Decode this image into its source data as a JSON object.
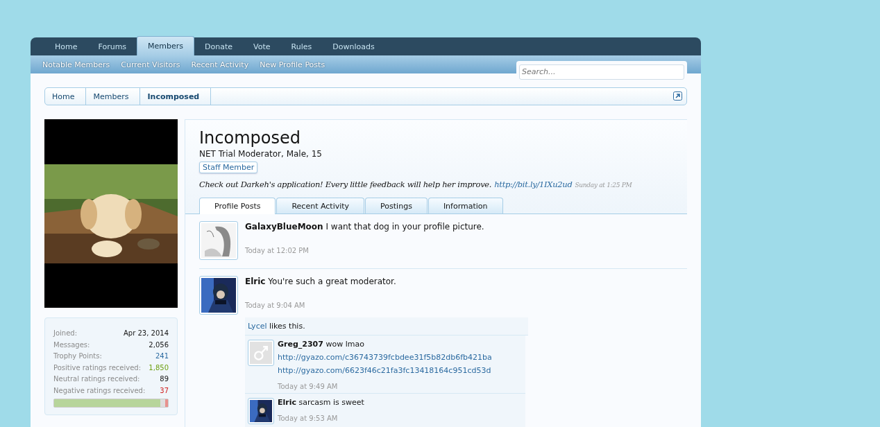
{
  "nav": {
    "tabs": [
      {
        "label": "Home",
        "selected": false
      },
      {
        "label": "Forums",
        "selected": false
      },
      {
        "label": "Members",
        "selected": true
      },
      {
        "label": "Donate",
        "selected": false
      },
      {
        "label": "Vote",
        "selected": false
      },
      {
        "label": "Rules",
        "selected": false
      },
      {
        "label": "Downloads",
        "selected": false
      }
    ],
    "subnav": [
      "Notable Members",
      "Current Visitors",
      "Recent Activity",
      "New Profile Posts"
    ],
    "search": {
      "placeholder": "Search..."
    }
  },
  "breadcrumb": [
    {
      "label": "Home",
      "current": false
    },
    {
      "label": "Members",
      "current": false
    },
    {
      "label": "Incomposed",
      "current": true
    }
  ],
  "sidebar": {
    "avatar": {
      "kind": "picture"
    },
    "stats": [
      {
        "label": "Joined:",
        "value": "Apr 23, 2014",
        "color": "#141414"
      },
      {
        "label": "Messages:",
        "value": "2,056",
        "color": "#141414"
      },
      {
        "label": "Trophy Points:",
        "value": "241",
        "color": "#2b6aa0"
      },
      {
        "label": "Positive ratings received:",
        "value": "1,850",
        "color": "#6c9f10"
      },
      {
        "label": "Neutral ratings received:",
        "value": "89",
        "color": "#141414"
      },
      {
        "label": "Negative ratings received:",
        "value": "37",
        "color": "#d02020"
      }
    ],
    "rating_bar": {
      "level": 0.93
    }
  },
  "profile": {
    "name": "Incomposed",
    "info": "NET Trial Moderator, Male, 15",
    "badge": "Staff Member",
    "status": {
      "text": "Check out Darkeh's application! Every little feedback will help her improve.",
      "link": "http://bit.ly/1IXu2ud",
      "time": "Sunday at 1:25 PM"
    },
    "tabs": [
      {
        "label": "Profile Posts",
        "selected": true
      },
      {
        "label": "Recent Activity",
        "selected": false
      },
      {
        "label": "Postings",
        "selected": false
      },
      {
        "label": "Information",
        "selected": false
      }
    ]
  },
  "posts": [
    {
      "author": "GalaxyBlueMoon",
      "avatar": {
        "kind": "sketch"
      },
      "message": "I want that dog in your profile picture.",
      "time": "Today at 12:02 PM"
    },
    {
      "author": "Elric",
      "avatar": {
        "kind": "picture"
      },
      "message": "You're such a great moderator.",
      "time": "Today at 9:04 AM",
      "likes": {
        "user": "Lycel",
        "text": "likes this."
      },
      "comments": [
        {
          "author": "Greg_2307",
          "avatar": {
            "kind": "male"
          },
          "message": "wow lmao",
          "links": [
            "http://gyazo.com/c36743739fcbdee31f5b82db6fb421ba",
            "http://gyazo.com/6623f46c21fa3fc13418164c951cd53d"
          ],
          "time": "Today at 9:49 AM"
        },
        {
          "author": "Elric",
          "avatar": {
            "kind": "picture"
          },
          "message": "sarcasm is sweet",
          "time": "Today at 9:53 AM"
        }
      ]
    }
  ]
}
